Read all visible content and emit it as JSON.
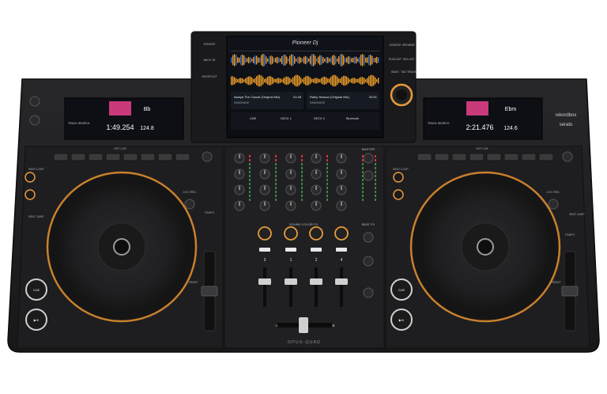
{
  "brand": {
    "pioneer_logo": "Pioneer Dj",
    "rekordbox": "rekordbox",
    "serato": "serato",
    "model": "OPUS-QUAD"
  },
  "colors": {
    "body": "#1c1c1e",
    "panel": "#232326",
    "accent_orange": "#e89a3c",
    "ring_orange": "#c9802c",
    "waveform_orange": "#f0a02a",
    "blue_wave": "#3a6fd8"
  },
  "screen": {
    "left_buttons": [
      "SOURCE",
      "BACK TA",
      "SHORTCUT"
    ],
    "right_buttons": [
      "SOURCE",
      "BROWSE",
      "PLAYLIST",
      "TAG LIST",
      "BACK",
      "TAG TRACK"
    ],
    "deck1": {
      "title": "Awaya The Clouds (Original Mix)",
      "artist": "SANSHADE",
      "time": "01:48"
    },
    "deck2": {
      "title": "Rainy Season (Original Mix)",
      "artist": "SANSHADE",
      "time": "00:51"
    },
    "bottom_labels": [
      "LINE",
      "DECK 1",
      "DECK 2",
      "Bluetooth"
    ]
  },
  "left_display": {
    "track_search": "TRACK SEARCH",
    "time": "1:49.254",
    "bpm": "124.8",
    "key": "Bb"
  },
  "right_display": {
    "track_search": "TRACK SEARCH",
    "time": "2:21.476",
    "bpm": "124.6",
    "key": "Ebm"
  },
  "mixer": {
    "channel_numbers": [
      "3",
      "1",
      "2",
      "4"
    ],
    "sound_color_fx": "SOUND COLOR FX",
    "beat_fx": "BEAT FX",
    "crossfader_a": "A",
    "crossfader_b": "B",
    "master": "MASTER"
  },
  "deck_buttons": {
    "cue": "CUE",
    "play": "▶/II",
    "hot_cue": "HOT CUE",
    "beat_loop": "BEAT LOOP",
    "beat_jump": "BEAT JUMP",
    "tempo": "TEMPO",
    "reset": "RESET",
    "jog_feel": "JOG FEEL"
  }
}
